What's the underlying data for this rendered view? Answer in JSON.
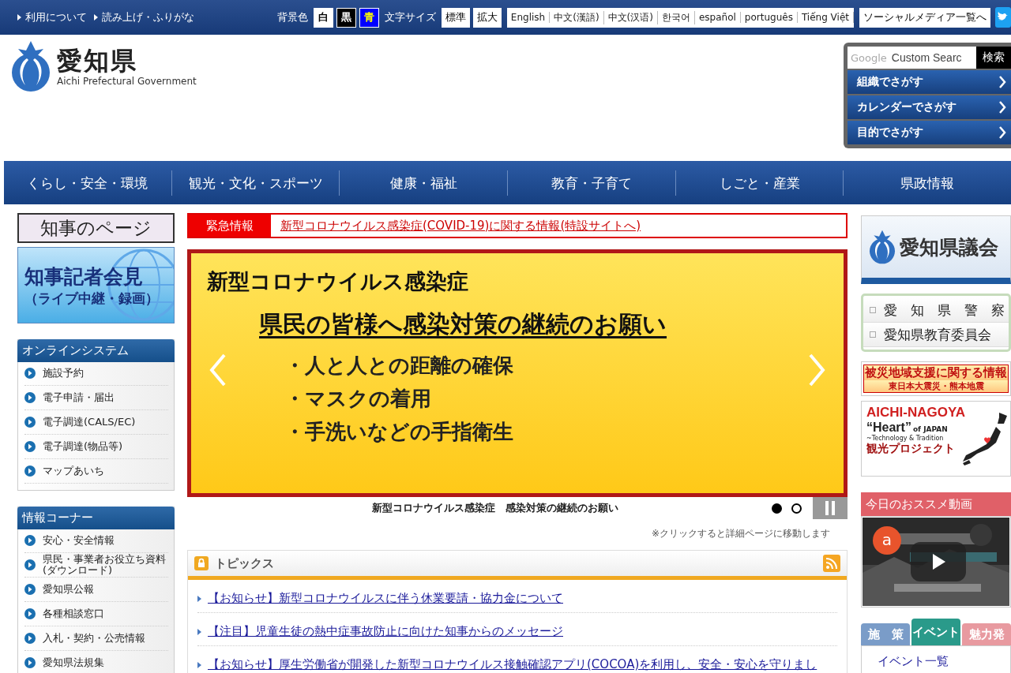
{
  "top_bar": {
    "links": [
      "利用について",
      "読み上げ・ふりがな"
    ],
    "bg_label": "背景色",
    "bg_options": [
      {
        "label": "白",
        "color": "#ffffff"
      },
      {
        "label": "黒",
        "color": "#000000"
      },
      {
        "label": "青",
        "color": "#0000ff"
      }
    ],
    "size_label": "文字サイズ",
    "size_options": [
      "標準",
      "拡大"
    ],
    "languages": [
      "English",
      "中文(漢語)",
      "中文(汉语)",
      "한국어",
      "español",
      "português",
      "Tiếng Việt"
    ],
    "social_button": "ソーシャルメディア一覧へ"
  },
  "header": {
    "logo_title": "愛知県",
    "logo_subtitle": "Aichi Prefectural Government",
    "search": {
      "brand": "Google",
      "placeholder": "Custom Searc",
      "button": "検索"
    },
    "search_links": [
      "組織でさがす",
      "カレンダーでさがす",
      "目的でさがす"
    ]
  },
  "nav": [
    "くらし・安全・環境",
    "観光・文化・スポーツ",
    "健康・福祉",
    "教育・子育て",
    "しごと・産業",
    "県政情報"
  ],
  "left": {
    "governor_page": "知事のページ",
    "press_banner": {
      "title": "知事記者会見",
      "subtitle": "（ライブ中継・録画）"
    },
    "panels": [
      {
        "title": "オンラインシステム",
        "items": [
          "施設予約",
          "電子申請・届出",
          "電子調達(CALS/EC)",
          "電子調達(物品等)",
          "マップあいち"
        ]
      },
      {
        "title": "情報コーナー",
        "items": [
          "安心・安全情報",
          "県民・事業者お役立ち資料(ダウンロード)",
          "愛知県公報",
          "各種相談窓口",
          "入札・契約・公売情報",
          "愛知県法規集"
        ]
      }
    ]
  },
  "center": {
    "emergency": {
      "label": "緊急情報",
      "link": "新型コロナウイルス感染症(COVID-19)に関する情報(特設サイトへ)"
    },
    "slide": {
      "title": "新型コロナウイルス感染症",
      "heading": "県民の皆様へ感染対策の継続のお願い",
      "bullets": [
        "・人と人との距離の確保",
        "・マスクの着用",
        "・手洗いなどの手指衛生"
      ]
    },
    "caption": "新型コロナウイルス感染症　感染対策の継続のお願い",
    "dots": [
      {
        "selected": true
      },
      {
        "selected": false
      }
    ],
    "note": "※クリックすると詳細ページに移動します",
    "topics": {
      "title": "トピックス",
      "items": [
        "【お知らせ】新型コロナウイルスに伴う休業要請・協力金について",
        "【注目】児童生徒の熱中症事故防止に向けた知事からのメッセージ",
        "【お知らせ】厚生労働省が開発した新型コロナウイルス接触確認アプリ(COCOA)を利用し、安全・安心を守りまし"
      ]
    }
  },
  "right": {
    "council": "愛知県議会",
    "links": [
      "愛　知　県　警　察",
      "愛知県教育委員会"
    ],
    "disaster": {
      "title": "被災地域支援に関する情報",
      "subtitle": "東日本大震災・熊本地震"
    },
    "tourism": {
      "title": "AICHI-NAGOYA",
      "heart": "“Heart”",
      "of": "of JAPAN",
      "tagline": "~Technology & Tradition",
      "project": "観光プロジェクト"
    },
    "video": {
      "title": "今日のおススメ動画",
      "channel": "a"
    },
    "tabs": [
      {
        "label": "施　策",
        "selected": false,
        "color": "#7a9cc8"
      },
      {
        "label": "イベント",
        "selected": true,
        "color": "#2a9a8a"
      },
      {
        "label": "魅力発",
        "selected": false,
        "color": "#e89aa0"
      }
    ],
    "tab_content": "イベント一覧"
  }
}
